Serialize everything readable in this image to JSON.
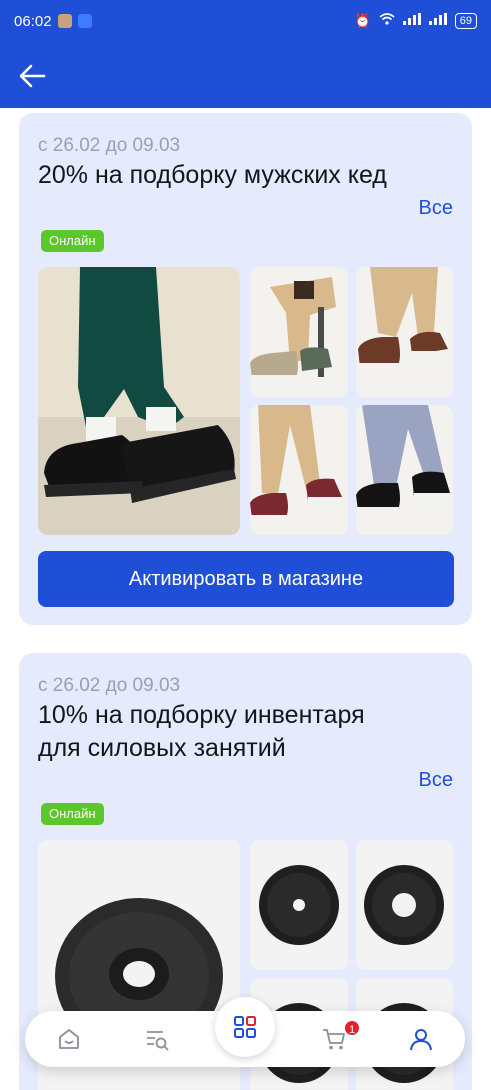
{
  "status_bar": {
    "time": "06:02",
    "battery": "69"
  },
  "promos": [
    {
      "date": "с 26.02 до 09.03",
      "title": "20% на подборку мужских кед",
      "all_label": "Все",
      "badge": "Онлайн",
      "button_label": "Активировать в магазине"
    },
    {
      "date": "с 26.02 до 09.03",
      "title": "10% на подборку инвентаря для силовых занятий",
      "all_label": "Все",
      "badge": "Онлайн"
    }
  ],
  "tabbar": {
    "cart_count": "1",
    "active_tab": "profile"
  },
  "colors": {
    "brand": "#1f4fd6",
    "badge": "#5bc72a",
    "card_bg": "#e5ebfd",
    "alert": "#e0212e"
  }
}
